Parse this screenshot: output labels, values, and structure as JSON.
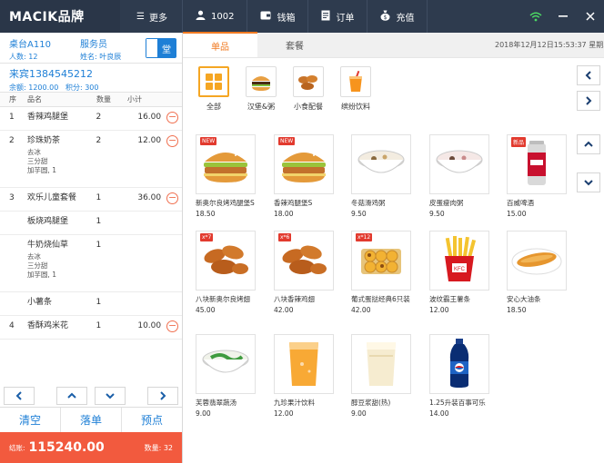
{
  "topbar": {
    "brand": "MACIK品牌",
    "more": "更多",
    "user": "1002",
    "wallet": "钱箱",
    "orders": "订单",
    "recharge": "充值"
  },
  "table": {
    "name": "桌台A110",
    "people": "人数: 12",
    "waiter_label": "服务员",
    "waiter_name": "姓名: 叶良辰",
    "dine_label": "堂"
  },
  "member": {
    "name": "来宾1384545212",
    "balance": "余额: 1200.00",
    "points": "积分: 300"
  },
  "order_columns": [
    "序",
    "品名",
    "数量",
    "小计"
  ],
  "order_items": [
    {
      "no": "1",
      "name": "香辣鸡腿堡",
      "mods": [],
      "qty": "2",
      "sub": "16.00",
      "del": true
    },
    {
      "no": "2",
      "name": "珍珠奶茶",
      "mods": [
        "去冰",
        "三分甜",
        "加芋圆, 1"
      ],
      "qty": "2",
      "sub": "12.00",
      "del": true
    },
    {
      "no": "3",
      "name": "欢乐儿童套餐",
      "mods": [],
      "qty": "1",
      "sub": "36.00",
      "del": true
    },
    {
      "no": "",
      "name": "板烧鸡腿堡",
      "mods": [],
      "qty": "1",
      "sub": "",
      "del": false
    },
    {
      "no": "",
      "name": "牛奶烧仙草",
      "mods": [
        "去冰",
        "三分甜",
        "加芋圆, 1"
      ],
      "qty": "1",
      "sub": "",
      "del": false
    },
    {
      "no": "",
      "name": "小薯条",
      "mods": [],
      "qty": "1",
      "sub": "",
      "del": false
    },
    {
      "no": "4",
      "name": "香酥鸡米花",
      "mods": [],
      "qty": "1",
      "sub": "10.00",
      "del": true
    }
  ],
  "actions": {
    "clear": "清空",
    "place": "落单",
    "reserve": "预点"
  },
  "total": {
    "label": "结账:",
    "amount": "115240.00",
    "qty": "数量: 32"
  },
  "tabs": [
    "单品",
    "套餐"
  ],
  "datetime": "2018年12月12日15:53:37  星期三",
  "categories": [
    {
      "label": "全部",
      "icon": "grid-icon"
    },
    {
      "label": "汉堡&粥",
      "icon": "burger-icon"
    },
    {
      "label": "小食配餐",
      "icon": "chicken-wings-icon"
    },
    {
      "label": "缤纷饮料",
      "icon": "juice-icon"
    }
  ],
  "products": [
    {
      "name": "新奥尔良烤鸡腿堡S",
      "price": "18.50",
      "tag": "NEW",
      "icon": "burger"
    },
    {
      "name": "香辣鸡腿堡S",
      "price": "18.00",
      "tag": "NEW",
      "icon": "burger"
    },
    {
      "name": "冬菇滑鸡粥",
      "price": "9.50",
      "tag": "",
      "icon": "porridge"
    },
    {
      "name": "皮蛋瘦肉粥",
      "price": "9.50",
      "tag": "",
      "icon": "porridge-pink"
    },
    {
      "name": "百威啤酒",
      "price": "15.00",
      "tag": "新品",
      "icon": "beer-can"
    },
    {
      "name": "八块新奥尔良烤翅",
      "price": "45.00",
      "tag": "x*7",
      "icon": "wings"
    },
    {
      "name": "八块香辣鸡翅",
      "price": "42.00",
      "tag": "x*6",
      "icon": "wings"
    },
    {
      "name": "葡式蛋挞经典6只装",
      "price": "42.00",
      "tag": "x*12",
      "icon": "egg-tart"
    },
    {
      "name": "波纹霸王薯条",
      "price": "12.00",
      "tag": "",
      "icon": "fries"
    },
    {
      "name": "安心大油条",
      "price": "18.50",
      "tag": "",
      "icon": "fritter"
    },
    {
      "name": "芙蓉翡翠蔬汤",
      "price": "9.00",
      "tag": "",
      "icon": "soup"
    },
    {
      "name": "九珍果汁饮料",
      "price": "12.00",
      "tag": "",
      "icon": "juice-glass"
    },
    {
      "name": "醇豆浆甜(热)",
      "price": "9.00",
      "tag": "",
      "icon": "soymilk"
    },
    {
      "name": "1.25升装百事可乐",
      "price": "14.00",
      "tag": "",
      "icon": "cola-bottle"
    }
  ],
  "colors": {
    "accent": "#1e7fd6",
    "orange": "#f07a22",
    "total_bg": "#f25a3e",
    "topbar": "#2e3b4e"
  }
}
